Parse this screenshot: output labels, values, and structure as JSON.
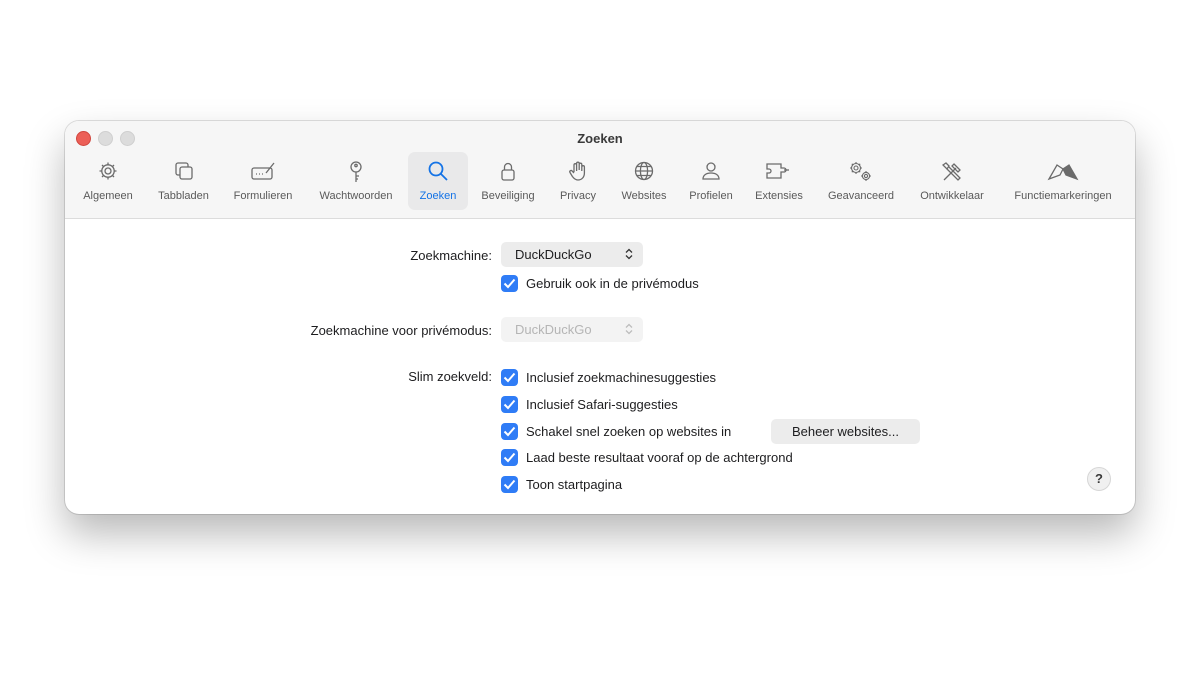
{
  "window": {
    "title": "Zoeken"
  },
  "tabs": [
    {
      "label": "Algemeen",
      "icon": "gear-icon"
    },
    {
      "label": "Tabbladen",
      "icon": "tabs-icon"
    },
    {
      "label": "Formulieren",
      "icon": "form-pencil-icon"
    },
    {
      "label": "Wachtwoorden",
      "icon": "key-icon"
    },
    {
      "label": "Zoeken",
      "icon": "search-icon",
      "active": true
    },
    {
      "label": "Beveiliging",
      "icon": "lock-icon"
    },
    {
      "label": "Privacy",
      "icon": "hand-icon"
    },
    {
      "label": "Websites",
      "icon": "globe-icon"
    },
    {
      "label": "Profielen",
      "icon": "person-icon"
    },
    {
      "label": "Extensies",
      "icon": "puzzle-icon"
    },
    {
      "label": "Geavanceerd",
      "icon": "gears-icon"
    },
    {
      "label": "Ontwikkelaar",
      "icon": "tools-icon"
    },
    {
      "label": "Functiemarkeringen",
      "icon": "flags-icon"
    }
  ],
  "search_engine": {
    "label": "Zoekmachine:",
    "value": "DuckDuckGo",
    "private_checkbox": {
      "label": "Gebruik ook in de privémodus",
      "checked": true
    }
  },
  "private_engine": {
    "label": "Zoekmachine voor privémodus:",
    "value": "DuckDuckGo",
    "disabled": true
  },
  "smart_field": {
    "label": "Slim zoekveld:",
    "options": [
      {
        "label": "Inclusief zoekmachinesuggesties",
        "checked": true
      },
      {
        "label": "Inclusief Safari-suggesties",
        "checked": true
      },
      {
        "label": "Schakel snel zoeken op websites in",
        "checked": true
      },
      {
        "label": "Laad beste resultaat vooraf op de achtergrond",
        "checked": true
      },
      {
        "label": "Toon startpagina",
        "checked": true
      }
    ],
    "manage_button": "Beheer websites..."
  },
  "help_label": "?",
  "colors": {
    "accent": "#2f7cf6",
    "active_tab_text": "#1473e6",
    "close": "#ec5f57"
  }
}
